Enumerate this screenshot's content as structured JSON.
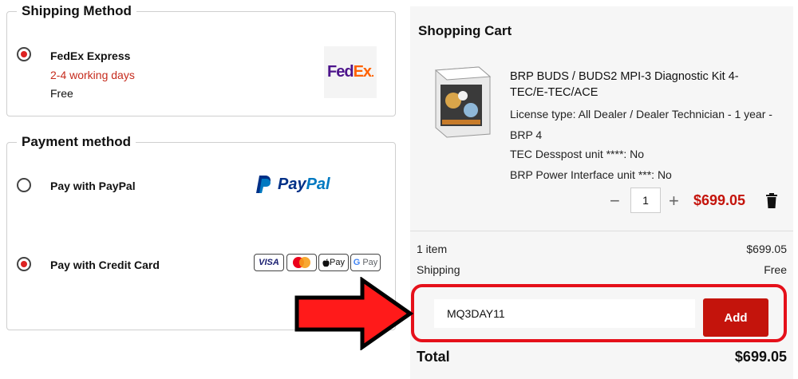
{
  "shipping": {
    "title": "Shipping Method",
    "option": {
      "name": "FedEx Express",
      "eta": "2-4 working days",
      "price": "Free",
      "logo_a": "Fed",
      "logo_b": "Ex",
      "logo_dot": "."
    }
  },
  "payment": {
    "title": "Payment method",
    "paypal": {
      "label": "Pay with PayPal",
      "logo_a": "Pay",
      "logo_b": "Pal"
    },
    "card": {
      "label": "Pay with Credit Card",
      "icons": [
        "VISA",
        "Mastercard",
        "Apple Pay",
        "G Pay"
      ],
      "applepay_text": "Pay",
      "gpay_text": "Pay"
    }
  },
  "cart": {
    "title": "Shopping Cart",
    "product": {
      "name": "BRP BUDS / BUDS2 MPI-3 Diagnostic Kit 4-TEC/E-TEC/ACE",
      "license": "License type: All Dealer / Dealer Technician - 1 year - BRP 4",
      "tec": "TEC Desspost unit ****: No",
      "brp_power": "BRP Power Interface unit ***: No",
      "qty": "1",
      "price": "$699.05"
    },
    "summary": {
      "items_label": "1 item",
      "items_value": "$699.05",
      "shipping_label": "Shipping",
      "shipping_value": "Free"
    },
    "coupon": {
      "value": "MQ3DAY11",
      "button": "Add"
    },
    "total": {
      "label": "Total",
      "value": "$699.05"
    }
  },
  "colors": {
    "accent": "#c4140c",
    "highlight": "#e5101a",
    "eta": "#c62b1d"
  }
}
